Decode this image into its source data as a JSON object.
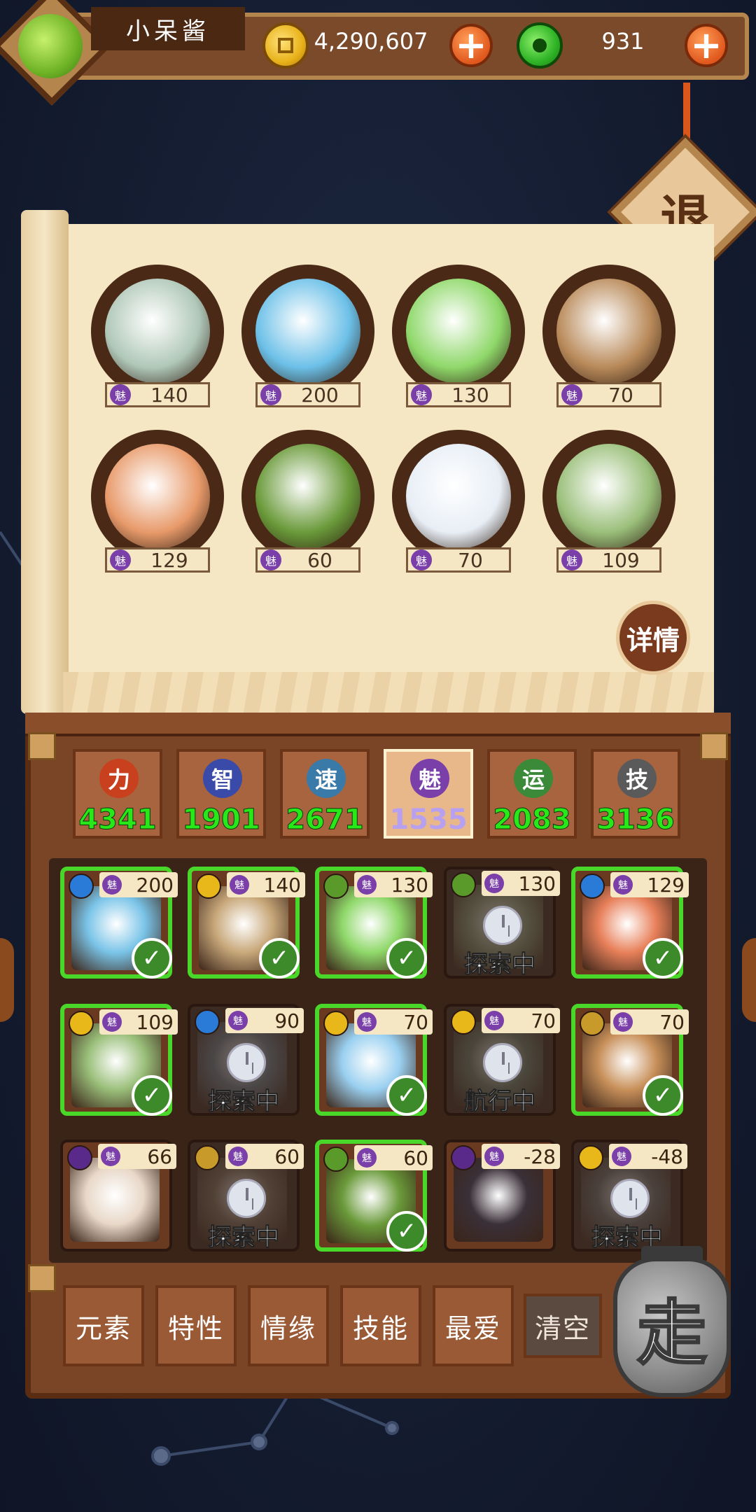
{
  "player": {
    "name": "小呆酱",
    "gold": "4,290,607",
    "jade": "931"
  },
  "exit_label": "退",
  "team": [
    {
      "charm": "140",
      "color": "#b0c8b8"
    },
    {
      "charm": "200",
      "color": "#6cc0e8"
    },
    {
      "charm": "130",
      "color": "#8fd86a"
    },
    {
      "charm": "70",
      "color": "#b98a5a"
    },
    {
      "charm": "129",
      "color": "#e89a6a"
    },
    {
      "charm": "60",
      "color": "#6a9a3a"
    },
    {
      "charm": "70",
      "color": "#e8eef5"
    },
    {
      "charm": "109",
      "color": "#9abf7a"
    }
  ],
  "charm_icon_label": "魅",
  "detail_label": "详情",
  "stats": [
    {
      "label": "力",
      "value": "4341",
      "color": "#c8401e"
    },
    {
      "label": "智",
      "value": "1901",
      "color": "#3a4aa8"
    },
    {
      "label": "速",
      "value": "2671",
      "color": "#3a7aa8"
    },
    {
      "label": "魅",
      "value": "1535",
      "color": "#7a3fa8"
    },
    {
      "label": "运",
      "value": "2083",
      "color": "#3a8a3a"
    },
    {
      "label": "技",
      "value": "3136",
      "color": "#5a5a5a"
    }
  ],
  "active_stat_index": 3,
  "pets": [
    {
      "charm": "200",
      "state": "selected",
      "element": "water",
      "art": "#7ac4e8"
    },
    {
      "charm": "140",
      "state": "selected",
      "element": "sun",
      "art": "#c8a87a"
    },
    {
      "charm": "130",
      "state": "selected",
      "element": "wood",
      "art": "#8fd86a"
    },
    {
      "charm": "130",
      "state": "busy",
      "element": "wood",
      "art": "#8a9a7a",
      "busy_text": "探索中"
    },
    {
      "charm": "129",
      "state": "selected",
      "element": "water",
      "art": "#e8805a"
    },
    {
      "charm": "109",
      "state": "selected",
      "element": "sun",
      "art": "#9abf7a"
    },
    {
      "charm": "90",
      "state": "busy",
      "element": "water",
      "art": "#6a7a8a",
      "busy_text": "探索中"
    },
    {
      "charm": "70",
      "state": "selected",
      "element": "sun",
      "art": "#9ad0f0"
    },
    {
      "charm": "70",
      "state": "busy",
      "element": "sun",
      "art": "#6a7a6a",
      "busy_text": "航行中"
    },
    {
      "charm": "70",
      "state": "selected",
      "element": "earth",
      "art": "#c8905a"
    },
    {
      "charm": "66",
      "state": "free",
      "element": "moon",
      "art": "#e8d8c8"
    },
    {
      "charm": "60",
      "state": "busy",
      "element": "earth",
      "art": "#7a6a5a",
      "busy_text": "探索中"
    },
    {
      "charm": "60",
      "state": "selected",
      "element": "wood",
      "art": "#6a9a3a"
    },
    {
      "charm": "-28",
      "state": "free",
      "element": "moon",
      "art": "#3a3038"
    },
    {
      "charm": "-48",
      "state": "busy",
      "element": "sun",
      "art": "#6a6a6a",
      "busy_text": "探索中"
    }
  ],
  "element_colors": {
    "water": "#2a7ad8",
    "sun": "#e8b81a",
    "wood": "#5a9a2a",
    "earth": "#c89a2a",
    "moon": "#5a2a8a"
  },
  "filters": [
    "元素",
    "特性",
    "情缘",
    "技能",
    "最爱"
  ],
  "clear_label": "清空",
  "go_label": "走"
}
